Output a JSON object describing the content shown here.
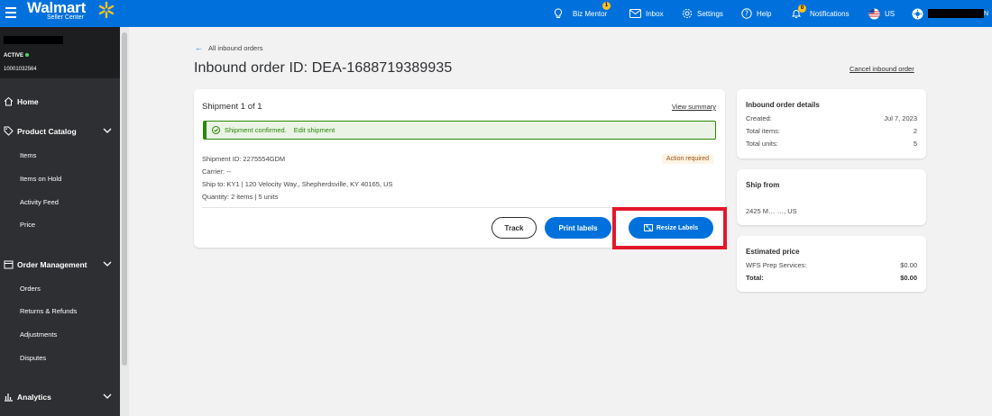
{
  "header": {
    "logo": "Walmart",
    "logo_sub": "Seller Center",
    "items": [
      {
        "label": "Biz Mentor",
        "badge": "1"
      },
      {
        "label": "Inbox"
      },
      {
        "label": "Settings"
      },
      {
        "label": "Help"
      },
      {
        "label": "Notifications",
        "badge": "0"
      },
      {
        "label": "US"
      }
    ],
    "user_suffix": "N",
    "colors": {
      "brand": "#0071dc",
      "spark": "#ffc220"
    }
  },
  "sidebar": {
    "status": "ACTIVE",
    "partner_id": "10001032564",
    "home": "Home",
    "sections": [
      {
        "title": "Product Catalog",
        "items": [
          "Items",
          "Items on Hold",
          "Activity Feed",
          "Price"
        ]
      },
      {
        "title": "Order Management",
        "items": [
          "Orders",
          "Returns & Refunds",
          "Adjustments",
          "Disputes"
        ]
      },
      {
        "title": "Analytics",
        "items": []
      }
    ]
  },
  "main": {
    "back_link": "All inbound orders",
    "title": "Inbound order ID: DEA-1688719389935",
    "cancel": "Cancel inbound order",
    "shipment": {
      "title": "Shipment 1 of 1",
      "view_summary": "View summary",
      "confirmed": "Shipment confirmed.",
      "edit": "Edit shipment",
      "id_line": "Shipment ID: 2275554GDM",
      "carrier_line": "Carrier: --",
      "ship_to_line": "Ship to: KY1 | 120 Velocity Way., Shepherdsville, KY 40165, US",
      "quantity_line": "Quantity: 2 items | 5 units",
      "action_required": "Action required",
      "track": "Track",
      "print": "Print labels",
      "resize": "Resize Labels"
    },
    "details": {
      "title": "Inbound order details",
      "rows": [
        {
          "label": "Created:",
          "value": "Jul 7, 2023"
        },
        {
          "label": "Total items:",
          "value": "2"
        },
        {
          "label": "Total units:",
          "value": "5"
        }
      ]
    },
    "ship_from": {
      "title": "Ship from",
      "address": "2425 M… …, US"
    },
    "estimated": {
      "title": "Estimated price",
      "rows": [
        {
          "label": "WFS Prep Services:",
          "value": "$0.00"
        },
        {
          "label": "Total:",
          "value": "$0.00"
        }
      ]
    },
    "highlight_color": "#e3172a"
  }
}
